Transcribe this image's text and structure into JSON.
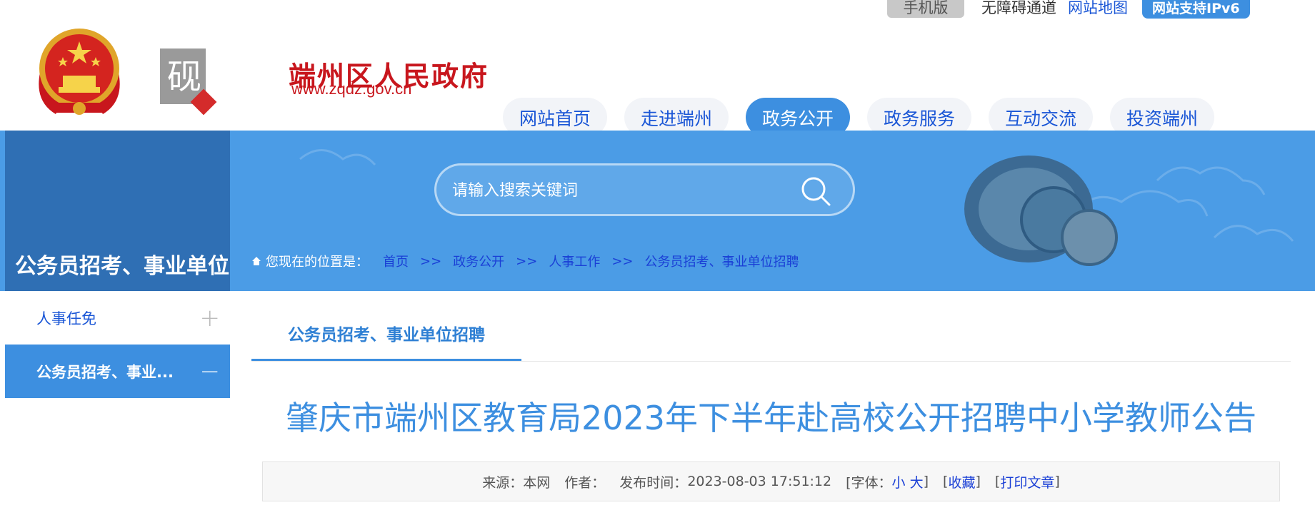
{
  "topbar": {
    "mobile": "手机版",
    "accessible": "无障碍通道",
    "sitemap": "网站地图",
    "ipv6": "网站支持IPv6"
  },
  "header": {
    "site_name": "端州区人民政府",
    "site_url": "www.zqdz.gov.cn"
  },
  "nav": [
    {
      "label": "网站首页"
    },
    {
      "label": "走进端州"
    },
    {
      "label": "政务公开",
      "active": true
    },
    {
      "label": "政务服务"
    },
    {
      "label": "互动交流"
    },
    {
      "label": "投资端州"
    }
  ],
  "banner": {
    "side_title": "公务员招考、事业单位",
    "search_placeholder": "请输入搜索关键词"
  },
  "breadcrumb": {
    "prefix": "您现在的位置是：",
    "items": [
      "首页",
      "政务公开",
      "人事工作",
      "公务员招考、事业单位招聘"
    ],
    "separator": ">>"
  },
  "sidebar": {
    "items": [
      {
        "label": "人事任免",
        "toggle": "+"
      },
      {
        "label": "公务员招考、事业...",
        "toggle": "−",
        "active": true
      }
    ]
  },
  "tab": {
    "label": "公务员招考、事业单位招聘"
  },
  "article": {
    "title": "肇庆市端州区教育局2023年下半年赴高校公开招聘中小学教师公告",
    "meta": {
      "source_label": "来源：",
      "source": "本网",
      "author_label": "作者：",
      "published_label": "发布时间：",
      "published": "2023-08-03 17:51:12",
      "font_label": "[字体：",
      "font_small": "小",
      "font_large": "大",
      "font_close": "]",
      "bookmark_open": "[",
      "bookmark": "收藏",
      "bookmark_close": "]",
      "print_open": "[",
      "print": "打印文章",
      "print_close": "]"
    }
  },
  "colors": {
    "accent": "#3d8fe0",
    "banner": "#4b9ce6",
    "side_title_bg": "#2f6fb4",
    "link": "#1a56d6",
    "brand_red": "#c8161d"
  }
}
